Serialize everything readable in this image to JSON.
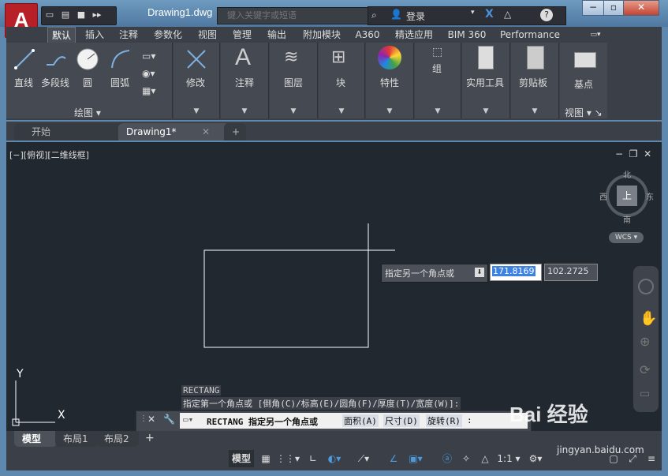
{
  "app": {
    "logo_letter": "A",
    "document_title": "Drawing1.dwg",
    "search_placeholder": "键入关键字或短语",
    "login_label": "登录",
    "help_label": "?"
  },
  "ribbon_tabs": [
    "默认",
    "插入",
    "注释",
    "参数化",
    "视图",
    "管理",
    "输出",
    "附加模块",
    "A360",
    "精选应用",
    "BIM 360",
    "Performance"
  ],
  "ribbon_panels": {
    "draw": {
      "tools": [
        "直线",
        "多段线",
        "圆",
        "圆弧"
      ],
      "footer": "绘图"
    },
    "modify": "修改",
    "annotate": "注释",
    "layers": "图层",
    "block": "块",
    "properties": "特性",
    "group": "组",
    "utilities": "实用工具",
    "clipboard": "剪贴板",
    "view": {
      "tool": "基点",
      "footer": "视图"
    }
  },
  "doc_tabs": {
    "start": "开始",
    "drawing": "Drawing1*",
    "add": "+"
  },
  "viewport": {
    "label": "[−][俯视][二维线框]",
    "viewcube": {
      "north": "北",
      "south": "南",
      "east": "东",
      "west": "西",
      "face": "上",
      "wcs": "WCS"
    },
    "ucs_x": "X",
    "ucs_y": "Y"
  },
  "dynamic_input": {
    "prompt": "指定另一个角点或",
    "x_value": "171.8169",
    "y_value": "102.2725"
  },
  "command": {
    "history_line1": "RECTANG",
    "history_line2": "指定第一个角点或 [倒角(C)/标高(E)/圆角(F)/厚度(T)/宽度(W)]:",
    "current": "RECTANG 指定另一个角点或",
    "options": [
      "面积(A)",
      "尺寸(D)",
      "旋转(R)"
    ],
    "suffix": ":"
  },
  "layout_tabs": [
    "模型",
    "布局1",
    "布局2"
  ],
  "status": {
    "model_label": "模型",
    "scale": "1:1"
  },
  "watermark": {
    "brand": "Bai 经验",
    "url": "jingyan.baidu.com"
  },
  "colors": {
    "accent_red": "#b62026",
    "canvas": "#212830",
    "selection": "#3d82e3"
  }
}
